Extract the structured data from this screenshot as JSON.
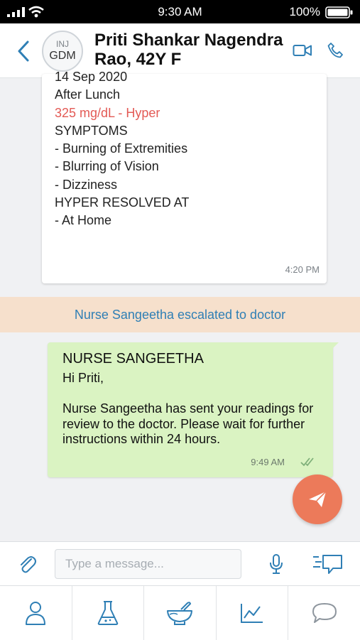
{
  "status_bar": {
    "time": "9:30 AM",
    "battery": "100%"
  },
  "header": {
    "avatar_line1": "INJ",
    "avatar_line2": "GDM",
    "title": "Priti Shankar Nagendra Rao, 42Y F"
  },
  "card": {
    "lines": [
      "14 Sep 2020",
      "After Lunch",
      "325 mg/dL - Hyper",
      "",
      "SYMPTOMS",
      "- Burning of Extremities",
      "- Blurring of Vision",
      "- Dizziness",
      "",
      "HYPER RESOLVED AT",
      "- At Home"
    ],
    "time": "4:20 PM"
  },
  "banner": "Nurse Sangeetha escalated to doctor",
  "bubble": {
    "sender": "NURSE SANGEETHA",
    "message": "Hi Priti,\n\nNurse Sangeetha has sent your readings for review to the doctor. Please wait for further instructions within 24 hours.",
    "time": "9:49  AM"
  },
  "composer": {
    "placeholder": "Type a message..."
  },
  "tabs": [
    "person-icon",
    "lab-flask-icon",
    "mortar-pestle-icon",
    "line-chart-icon",
    "chat-bubble-icon"
  ],
  "colors": {
    "accent": "#2f7fb5",
    "hyper": "#e35a55",
    "banner_bg": "#f6e0cc",
    "bubble_bg": "#daf3c2",
    "fab": "#ec7a5a"
  }
}
